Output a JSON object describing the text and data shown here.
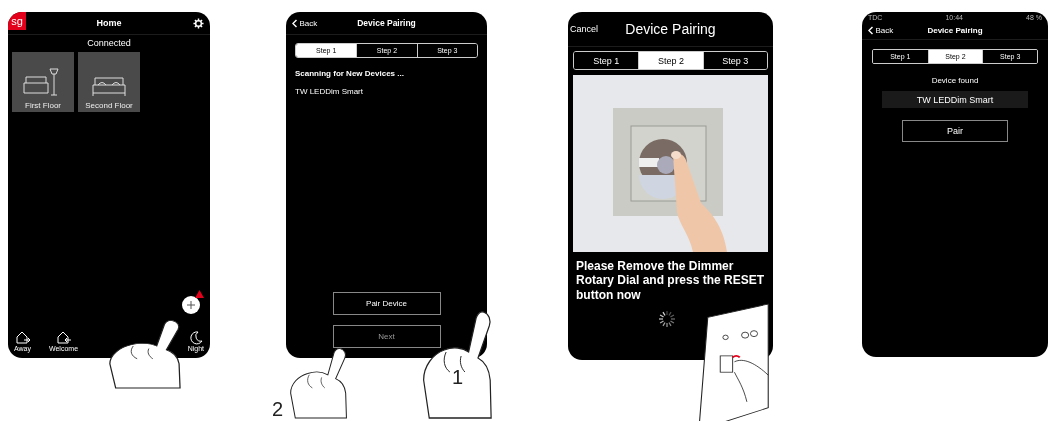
{
  "screens": [
    {
      "kind": "home",
      "logo": "sg",
      "title": "Home",
      "status": "Connected",
      "rooms": [
        {
          "name": "First Floor"
        },
        {
          "name": "Second Floor"
        }
      ],
      "add_alert": true,
      "scenes": [
        {
          "label": "Away"
        },
        {
          "label": "Welcome"
        },
        {
          "label": "Night"
        }
      ]
    },
    {
      "kind": "scan",
      "back": "Back",
      "title": "Device Pairing",
      "steps": [
        {
          "label": "Step 1",
          "selected": true
        },
        {
          "label": "Step 2",
          "selected": false
        },
        {
          "label": "Step 3",
          "selected": false
        }
      ],
      "heading": "Scanning for New Devices ...",
      "device": "TW LEDDim Smart",
      "buttons": [
        {
          "label": "Pair Device",
          "disabled": false
        },
        {
          "label": "Next",
          "disabled": true
        }
      ]
    },
    {
      "kind": "reset",
      "cancel": "Cancel",
      "title": "Device Pairing",
      "steps": [
        {
          "label": "Step 1",
          "selected": false
        },
        {
          "label": "Step 2",
          "selected": true
        },
        {
          "label": "Step 3",
          "selected": false
        }
      ],
      "instruction": "Please Remove the Dimmer Rotary Dial and press the RESET button now"
    },
    {
      "kind": "found",
      "carrier": "TDC",
      "time": "10:44",
      "battery": "48 %",
      "back": "Back",
      "title": "Device Pairing",
      "steps": [
        {
          "label": "Step 1",
          "selected": false
        },
        {
          "label": "Step 2",
          "selected": true
        },
        {
          "label": "Step 3",
          "selected": false
        }
      ],
      "heading": "Device found",
      "device": "TW LEDDim Smart",
      "button": "Pair"
    }
  ],
  "callouts": [
    "1",
    "2"
  ]
}
